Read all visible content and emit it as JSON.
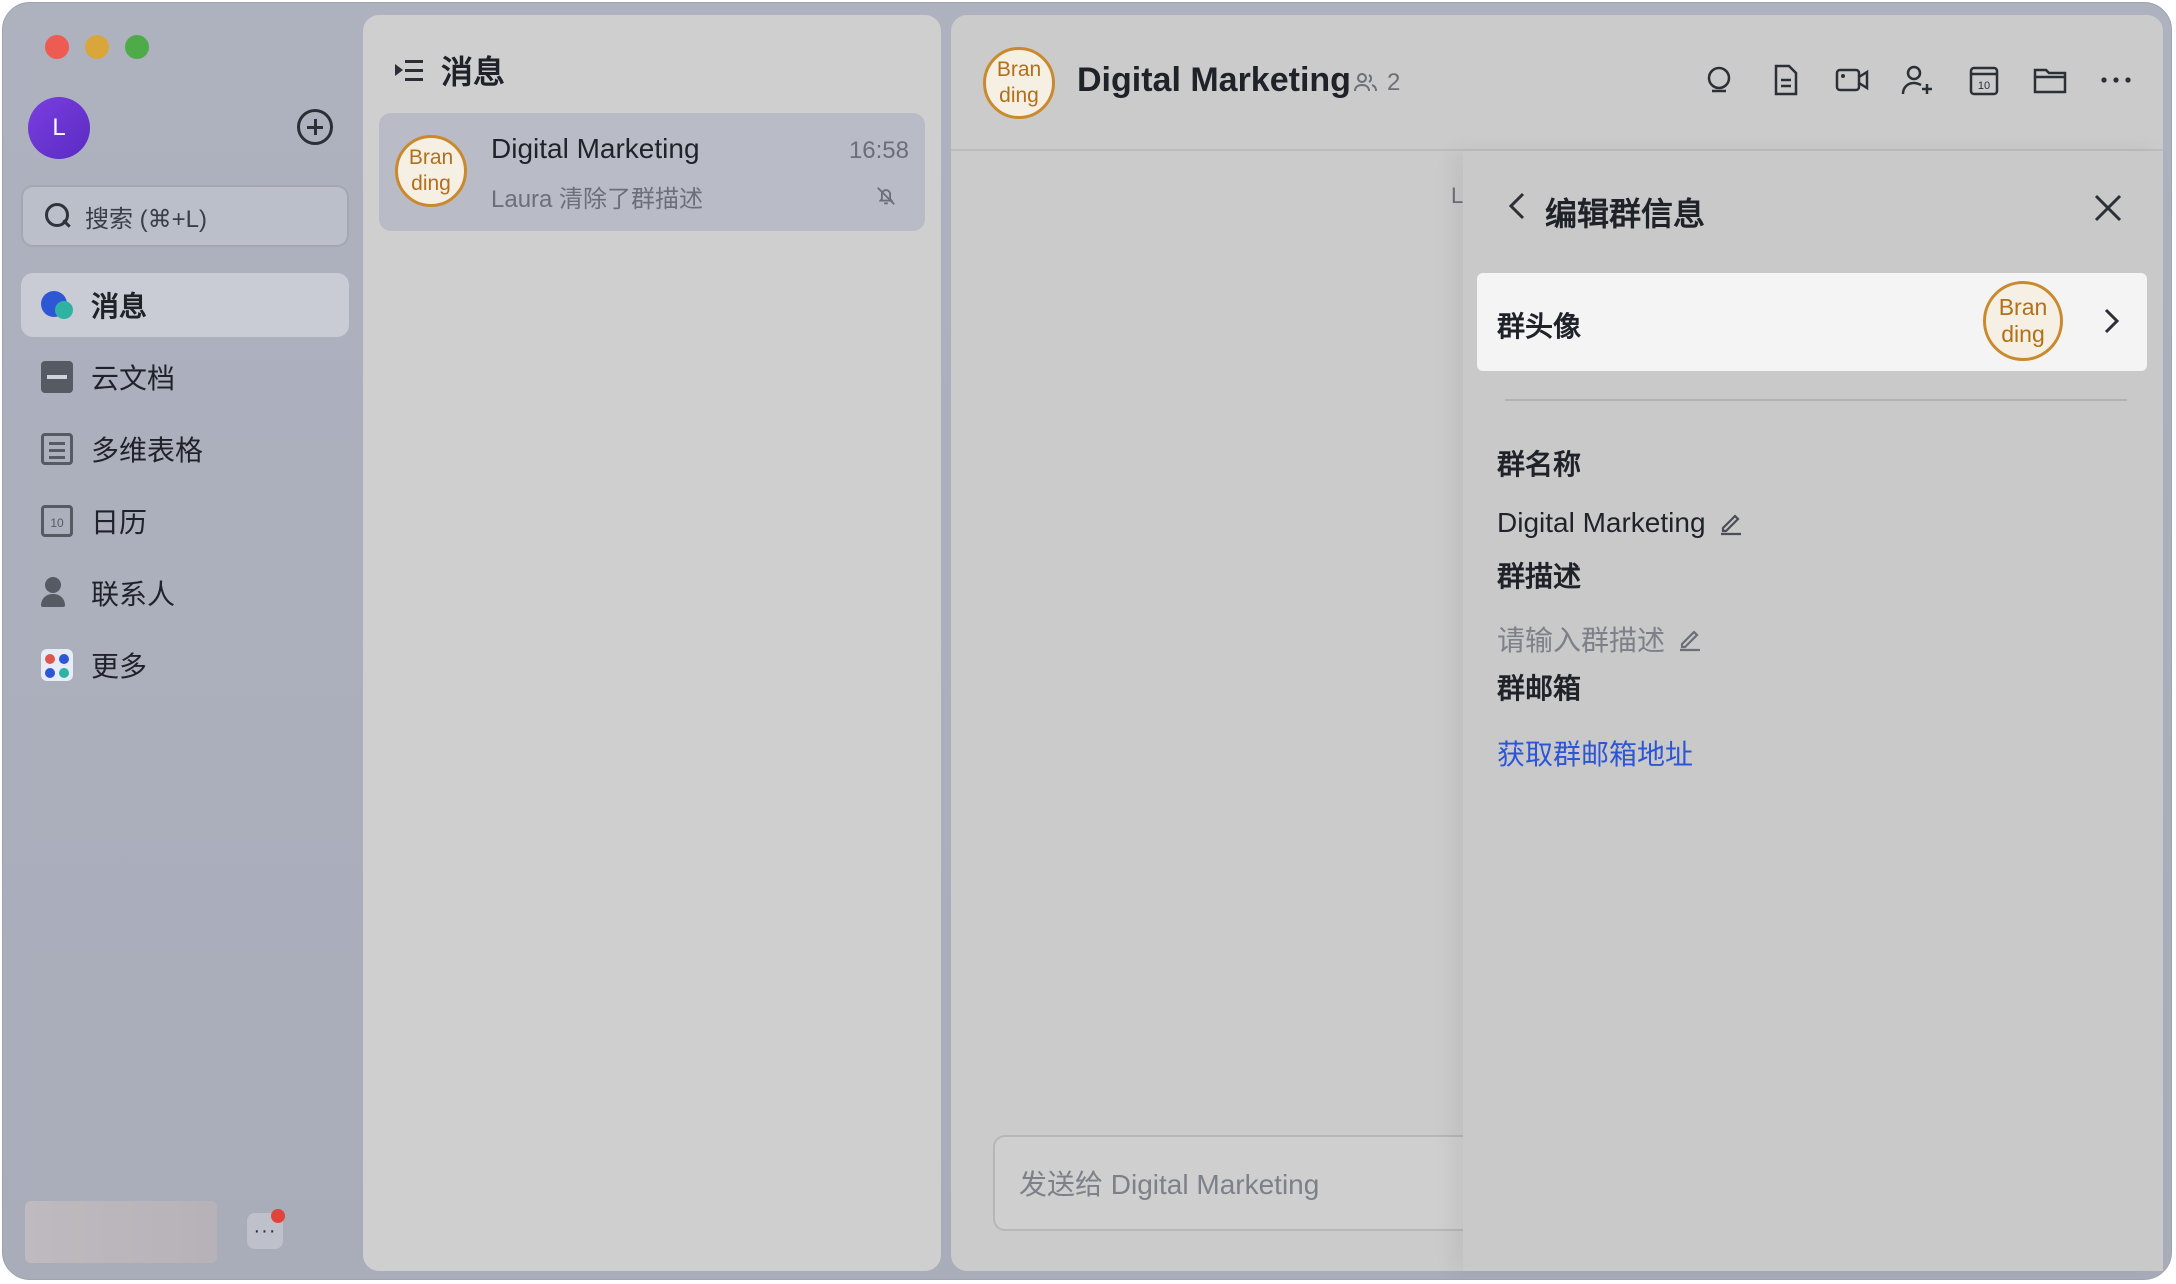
{
  "sidebar": {
    "avatar_letter": "L",
    "search_placeholder": "搜索 (⌘+L)",
    "nav": [
      {
        "label": "消息",
        "icon": "message-icon",
        "active": true
      },
      {
        "label": "云文档",
        "icon": "cloud-doc-icon"
      },
      {
        "label": "多维表格",
        "icon": "base-table-icon"
      },
      {
        "label": "日历",
        "icon": "calendar-icon"
      },
      {
        "label": "联系人",
        "icon": "contacts-icon"
      },
      {
        "label": "更多",
        "icon": "more-apps-icon"
      }
    ],
    "calendar_day": "10",
    "more_label": "···"
  },
  "message_list": {
    "title": "消息",
    "conversations": [
      {
        "avatar_line1": "Bran",
        "avatar_line2": "ding",
        "name": "Digital Marketing",
        "preview": "Laura 清除了群描述",
        "time": "16:58",
        "muted": true
      }
    ]
  },
  "chat": {
    "avatar_line1": "Bran",
    "avatar_line2": "ding",
    "title": "Digital Marketing",
    "member_count": "2",
    "peek_char": "L",
    "composer_placeholder": "发送给 Digital Marketing",
    "calendar_day": "10",
    "tools": [
      "search-icon",
      "doc-icon",
      "video-icon",
      "add-member-icon",
      "calendar-icon",
      "folder-icon",
      "more-icon"
    ]
  },
  "drawer": {
    "title": "编辑群信息",
    "avatar_label": "群头像",
    "avatar_line1": "Bran",
    "avatar_line2": "ding",
    "name_label": "群名称",
    "name_value": "Digital Marketing",
    "desc_label": "群描述",
    "desc_placeholder": "请输入群描述",
    "mail_label": "群邮箱",
    "mail_link": "获取群邮箱地址"
  },
  "colors": {
    "accent_blue": "#2d56d6",
    "brand_orange": "#c98a2e",
    "notification_red": "#e0443a"
  }
}
